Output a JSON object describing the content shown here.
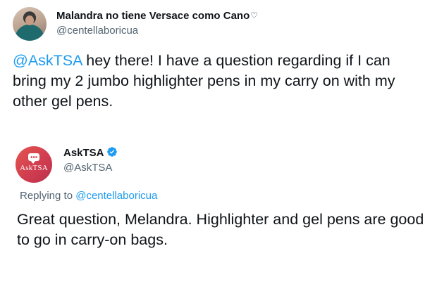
{
  "tweet": {
    "author": {
      "display_name": "Malandra no tiene Versace como Cano",
      "name_emoji": "♡",
      "handle": "@centellaboricua"
    },
    "mention": "@AskTSA",
    "text": " hey there! I have a question regarding if I can bring my 2 jumbo highlighter pens in my carry on with my other gel pens."
  },
  "reply": {
    "author": {
      "display_name": "AskTSA",
      "handle": "@AskTSA",
      "avatar_text": "AskTSA",
      "verified_color": "#1d9bf0"
    },
    "replying_prefix": "Replying to ",
    "replying_to": "@centellaboricua",
    "text": "Great question, Melandra. Highlighter and gel pens are good to go in carry-on bags."
  },
  "colors": {
    "mention": "#1d9bf0",
    "secondary_text": "#536471",
    "primary_text": "#0f1419"
  }
}
